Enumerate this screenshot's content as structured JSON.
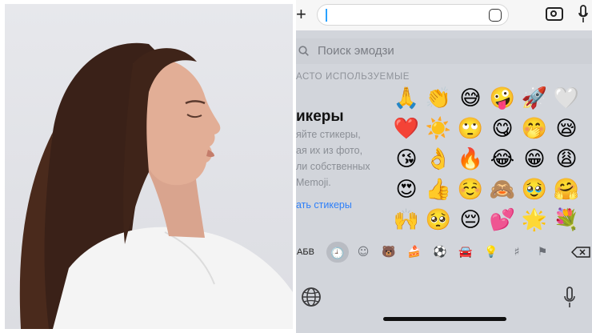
{
  "search": {
    "placeholder": "Поиск эмодзи"
  },
  "section": {
    "label": "АСТО ИСПОЛЬЗУЕМЫЕ"
  },
  "stickers": {
    "title": "икеры",
    "desc_lines": [
      "яйте стикеры,",
      "ая их из фото,",
      "ли собственных",
      "Memoji."
    ],
    "link": "ать стикеры"
  },
  "emoji_rows": [
    [
      "🙏",
      "👏",
      "😅",
      "🤪",
      "🚀",
      "🤍"
    ],
    [
      "❤️",
      "☀️",
      "🙄",
      "😋",
      "🤭",
      "😪"
    ],
    [
      "😘",
      "👌",
      "🔥",
      "😂",
      "😁",
      "😩"
    ],
    [
      "😍",
      "👍",
      "☺️",
      "🙈",
      "🥹",
      "🤗"
    ],
    [
      "🙌",
      "🥺",
      "😔",
      "💕",
      "🌟",
      "💐"
    ]
  ],
  "categories": {
    "abc": "АБВ",
    "icons": [
      "clock-icon",
      "smiley-icon",
      "bear-icon",
      "cake-icon",
      "ball-icon",
      "car-icon",
      "bulb-icon",
      "symbols-icon",
      "flag-icon"
    ],
    "glyphs": [
      "🕘",
      "☺",
      "🐻",
      "🍰",
      "⚽",
      "🚘",
      "💡",
      "♯",
      "⚑"
    ],
    "selected": "clock-icon"
  }
}
